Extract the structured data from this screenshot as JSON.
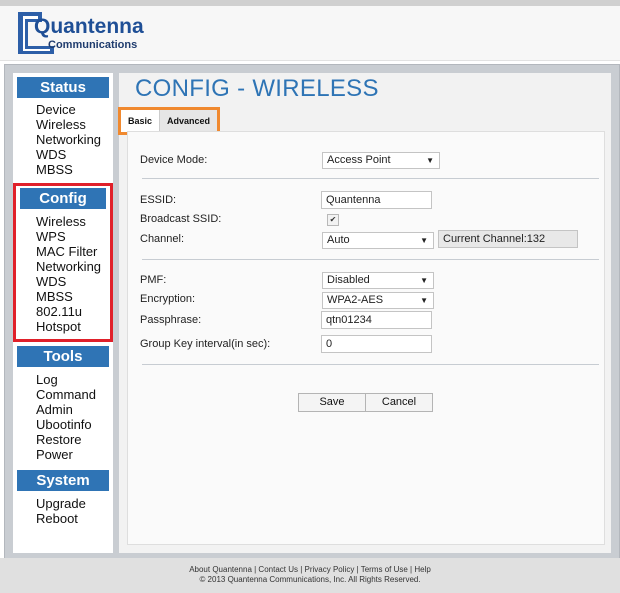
{
  "brand": {
    "name": "Quantenna",
    "tagline": "Communications"
  },
  "sidebar": {
    "status": {
      "title": "Status",
      "items": [
        "Device",
        "Wireless",
        "Networking",
        "WDS",
        "MBSS"
      ]
    },
    "config": {
      "title": "Config",
      "items": [
        "Wireless",
        "WPS",
        "MAC Filter",
        "Networking",
        "WDS",
        "MBSS",
        "802.11u",
        "Hotspot"
      ]
    },
    "tools": {
      "title": "Tools",
      "items": [
        "Log",
        "Command",
        "Admin",
        "Ubootinfo",
        "Restore",
        "Power"
      ]
    },
    "system": {
      "title": "System",
      "items": [
        "Upgrade",
        "Reboot"
      ]
    }
  },
  "main": {
    "title": "CONFIG - WIRELESS",
    "tabs": {
      "basic": "Basic",
      "advanced": "Advanced"
    },
    "form": {
      "device_mode": {
        "label": "Device Mode:",
        "value": "Access Point"
      },
      "essid": {
        "label": "ESSID:",
        "value": "Quantenna"
      },
      "broadcast_ssid": {
        "label": "Broadcast SSID:",
        "checked": true
      },
      "channel": {
        "label": "Channel:",
        "value": "Auto",
        "current": "Current Channel:132"
      },
      "pmf": {
        "label": "PMF:",
        "value": "Disabled"
      },
      "encryption": {
        "label": "Encryption:",
        "value": "WPA2-AES"
      },
      "passphrase": {
        "label": "Passphrase:",
        "value": "qtn01234"
      },
      "group_key": {
        "label": "Group Key interval(in sec):",
        "value": "0"
      }
    },
    "buttons": {
      "save": "Save",
      "cancel": "Cancel"
    }
  },
  "footer": {
    "links": "About Quantenna | Contact Us | Privacy Policy | Terms of Use | Help",
    "copyright": "© 2013 Quantenna Communications, Inc. All Rights Reserved."
  },
  "colors": {
    "accent": "#2f74b5",
    "highlight_red": "#e0202a",
    "highlight_orange": "#f0892f"
  }
}
